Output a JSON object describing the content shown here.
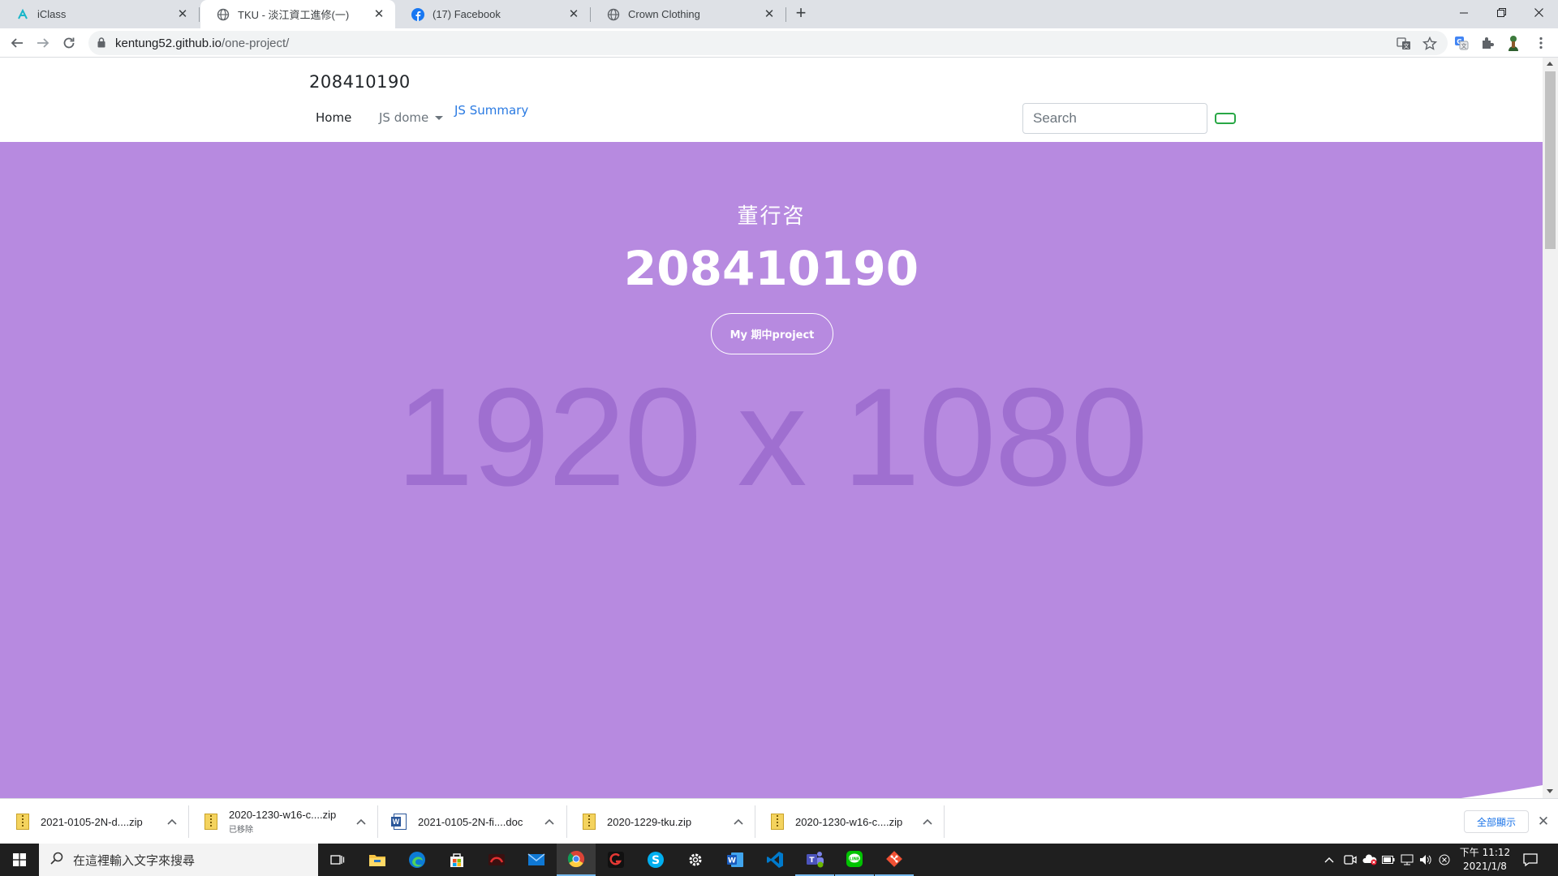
{
  "browser": {
    "tabs": [
      {
        "title": "iClass",
        "icon": "iclass-icon",
        "active": false
      },
      {
        "title": "TKU - 淡江資工進修(一)",
        "icon": "globe-icon",
        "active": true
      },
      {
        "title": "(17) Facebook",
        "icon": "facebook-icon",
        "active": false
      },
      {
        "title": "Crown Clothing",
        "icon": "globe-icon",
        "active": false
      }
    ],
    "url_host": "kentung52.github.io",
    "url_path": "/one-project/"
  },
  "page": {
    "brand": "208410190",
    "nav": {
      "home": "Home",
      "js_dome": "JS dome",
      "js_summary": "JS Summary"
    },
    "search": {
      "placeholder": "Search"
    },
    "hero": {
      "subtitle": "董行咨",
      "title": "208410190",
      "button": "My 期中project",
      "placeholder_text": "1920 x 1080",
      "background": "#b78ae0"
    }
  },
  "downloads": {
    "items": [
      {
        "name": "2021-0105-2N-d....zip",
        "type": "zip",
        "status": ""
      },
      {
        "name": "2020-1230-w16-c....zip",
        "type": "zip",
        "status": "已移除"
      },
      {
        "name": "2021-0105-2N-fi....doc",
        "type": "doc",
        "status": ""
      },
      {
        "name": "2020-1229-tku.zip",
        "type": "zip",
        "status": ""
      },
      {
        "name": "2020-1230-w16-c....zip",
        "type": "zip",
        "status": ""
      }
    ],
    "show_all": "全部顯示"
  },
  "taskbar": {
    "search_placeholder": "在這裡輸入文字來搜尋",
    "time": "下午 11:12",
    "date": "2021/1/8",
    "apps": [
      "task-view-icon",
      "file-explorer-icon",
      "edge-icon",
      "store-icon",
      "game-icon",
      "mail-icon",
      "chrome-icon",
      "garena-icon",
      "skype-icon",
      "settings-icon",
      "word-icon",
      "vscode-icon",
      "teams-icon",
      "line-icon",
      "git-icon"
    ]
  }
}
